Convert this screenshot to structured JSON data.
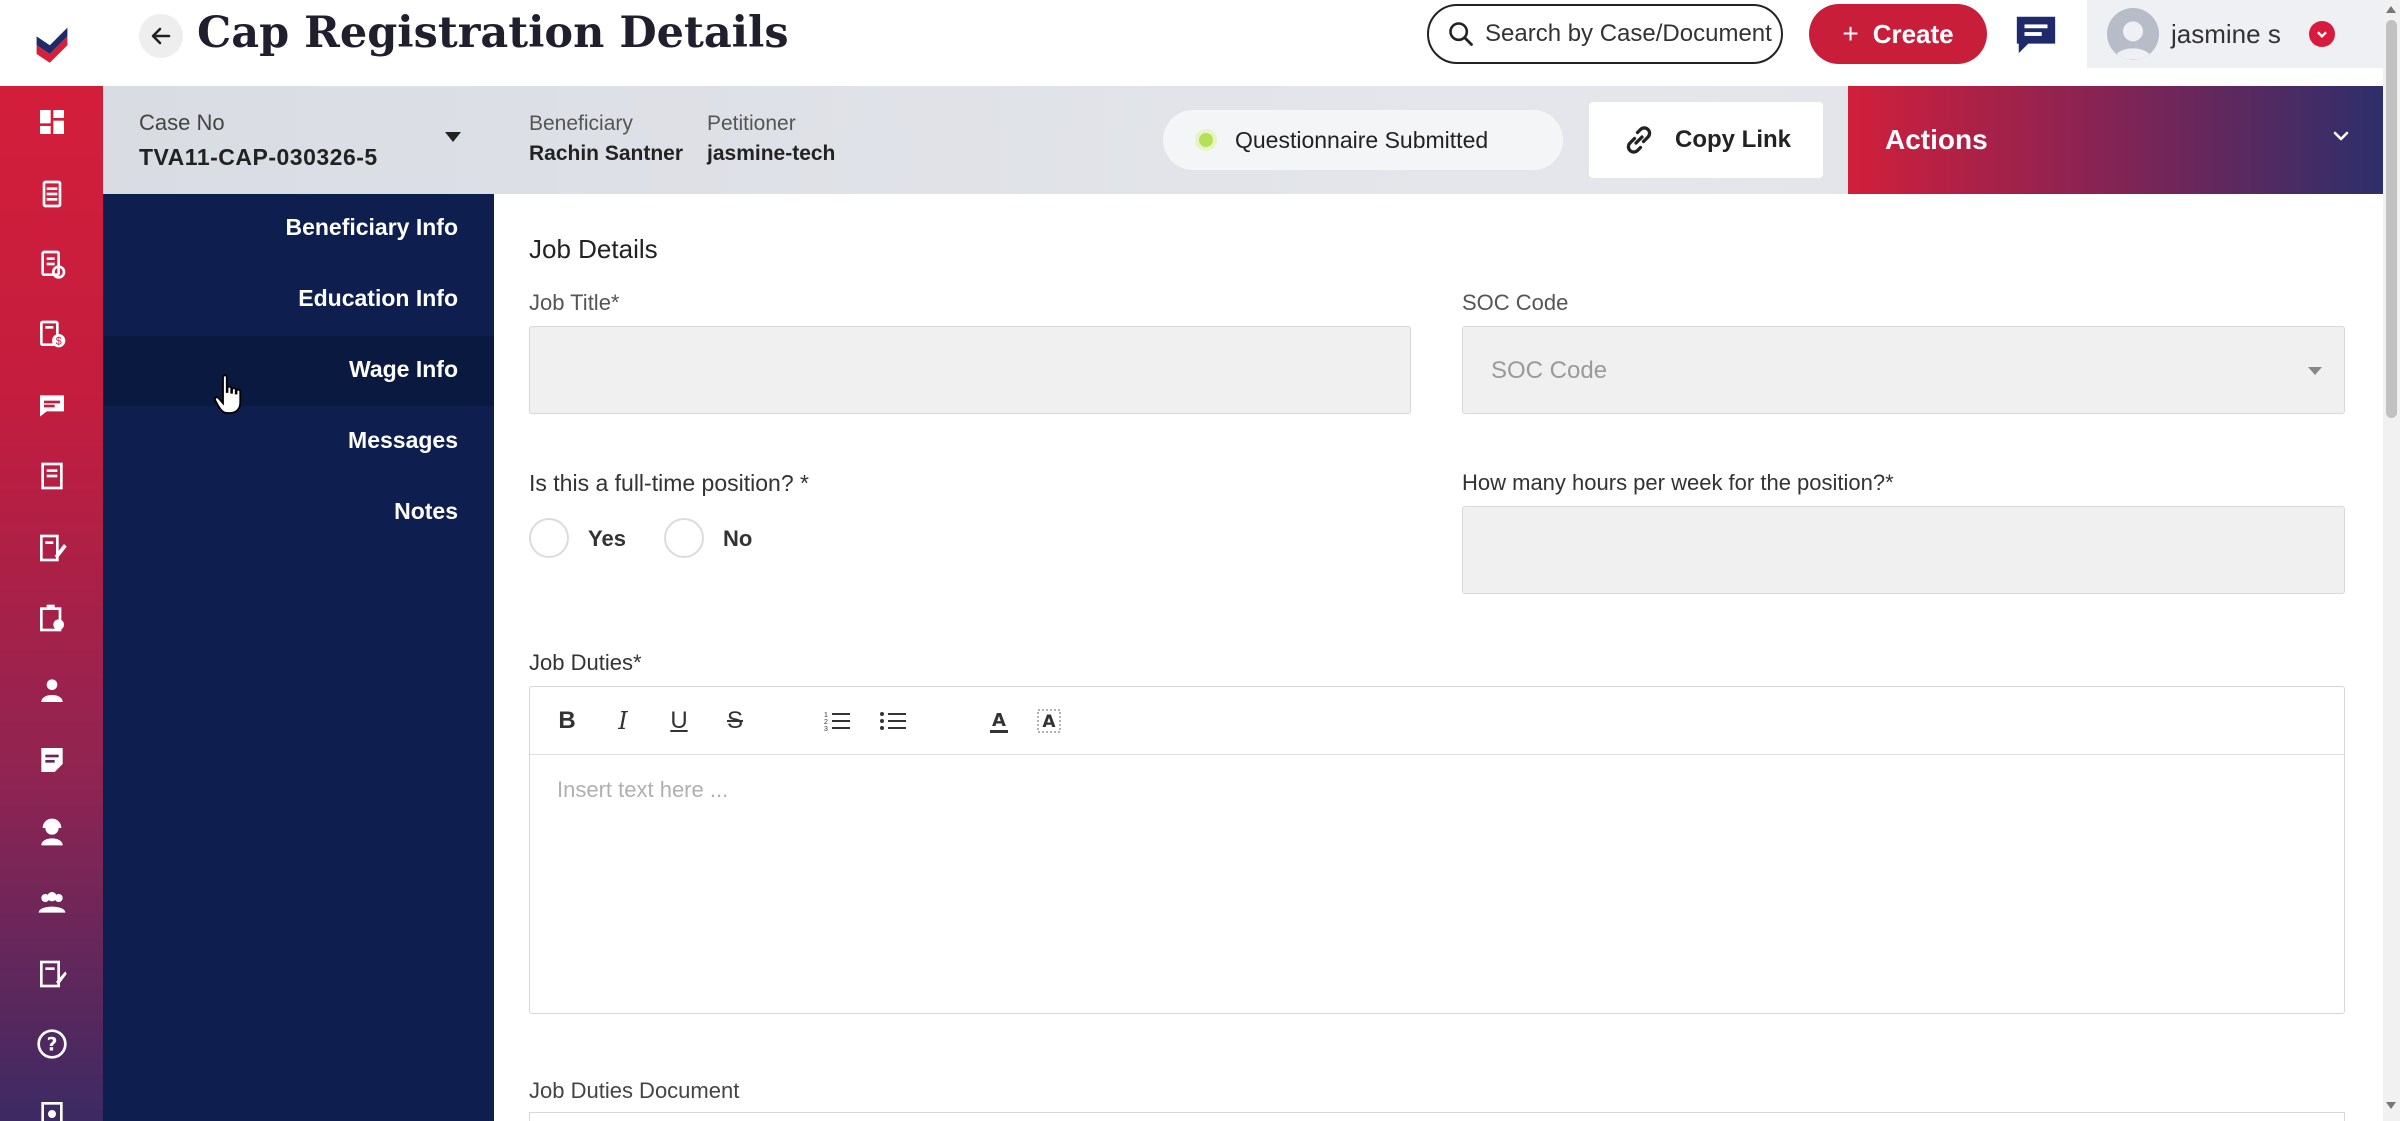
{
  "header": {
    "title": "Cap Registration Details",
    "search_placeholder": "Search by Case/Document",
    "create_label": "Create",
    "user_name": "jasmine s"
  },
  "case_bar": {
    "case_label": "Case No",
    "case_number": "TVA11-CAP-030326-5",
    "beneficiary_label": "Beneficiary",
    "beneficiary_name": "Rachin Santner",
    "petitioner_label": "Petitioner",
    "petitioner_name": "jasmine-tech",
    "status": "Questionnaire Submitted",
    "copy_link_label": "Copy Link",
    "actions_label": "Actions"
  },
  "sidenav": {
    "items": [
      {
        "label": "Beneficiary Info"
      },
      {
        "label": "Education Info"
      },
      {
        "label": "Wage Info"
      },
      {
        "label": "Messages"
      },
      {
        "label": "Notes"
      }
    ]
  },
  "form": {
    "section_title": "Job Details",
    "job_title_label": "Job Title*",
    "job_title_value": "",
    "soc_label": "SOC Code",
    "soc_placeholder": "SOC Code",
    "full_time_label": "Is this a full-time position? *",
    "yes_label": "Yes",
    "no_label": "No",
    "hours_label": "How many hours per week for the position?*",
    "hours_value": "",
    "duties_label": "Job Duties*",
    "duties_placeholder": "Insert text here ...",
    "duties_doc_label": "Job Duties Document"
  },
  "icons": {
    "rail": [
      "dashboard-icon",
      "documents-icon",
      "form-check-icon",
      "billing-icon",
      "chat-icon",
      "book-icon",
      "edit-form-icon",
      "clipboard-icon",
      "user-icon",
      "notes-icon",
      "support-agent-icon",
      "team-icon",
      "reports-icon",
      "help-icon",
      "settings-icon"
    ]
  },
  "colors": {
    "brand_red": "#c81e3a",
    "navy": "#0e1f4f",
    "status_green": "#b5e05a"
  }
}
